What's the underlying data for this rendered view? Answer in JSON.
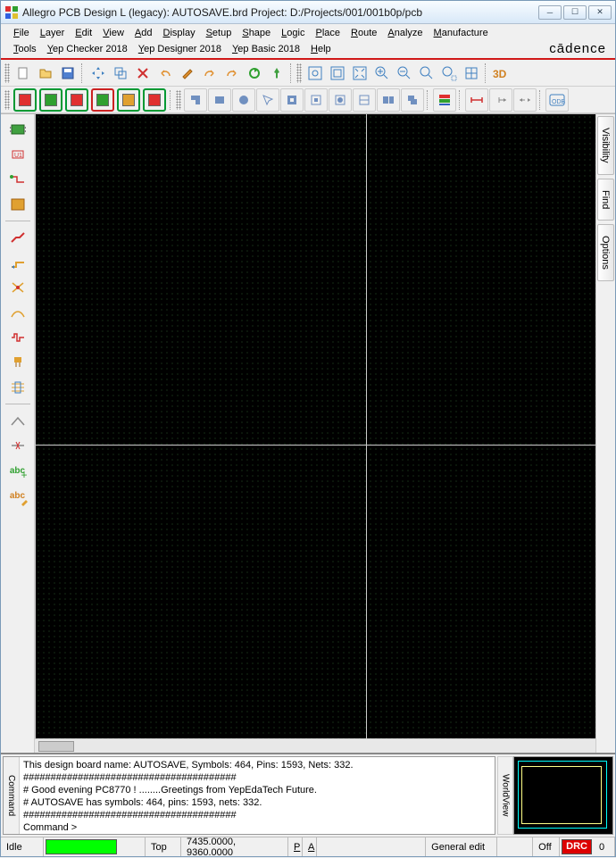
{
  "title": "Allegro PCB Design L (legacy): AUTOSAVE.brd  Project: D:/Projects/001/001b0p/pcb",
  "menus": [
    "File",
    "Layer",
    "Edit",
    "View",
    "Add",
    "Display",
    "Setup",
    "Shape",
    "Logic",
    "Place",
    "Route",
    "Analyze",
    "Manufacture",
    "Tools",
    "Yep Checker 2018",
    "Yep Designer 2018",
    "Yep Basic 2018",
    "Help"
  ],
  "brand": "cādence",
  "right_tabs": [
    "Visibility",
    "Find",
    "Options"
  ],
  "console": {
    "tab": "Command",
    "lines": [
      "This design board name: AUTOSAVE, Symbols: 464, Pins: 1593, Nets: 332.",
      "#######################################",
      "#  Good evening PC8770 !       ........Greetings from YepEdaTech Future.",
      "#  AUTOSAVE has symbols: 464, pins: 1593, nets: 332.",
      "#######################################",
      "Command >"
    ]
  },
  "worldview_tab": "WorldView",
  "status": {
    "idle": "Idle",
    "layer": "Top",
    "coords": "7435.0000, 9360.0000",
    "p": "P",
    "a": "A",
    "mode": "General edit",
    "off": "Off",
    "drc": "DRC",
    "drc_count": "0"
  }
}
